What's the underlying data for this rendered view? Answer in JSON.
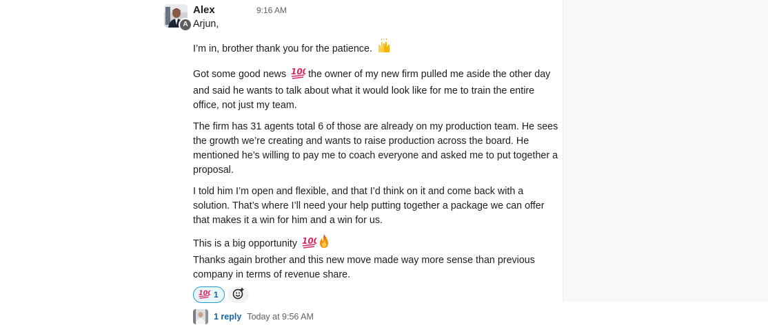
{
  "message": {
    "sender": "Alex",
    "avatar_initial": "A",
    "time": "9:16 AM",
    "paragraphs": [
      {
        "lines": [
          "Arjun,"
        ]
      },
      {
        "lines": [
          "I’m in, brother thank you for the patience."
        ],
        "trailing_emoji": "raised-hands"
      },
      {
        "lines": [
          "Got some good news",
          "and said he wants to talk about what it would look like for me to train the entire",
          "office, not just my team."
        ],
        "inline_emoji": "hundred-points",
        "line1_rest": "the owner of my new firm pulled me aside the other day"
      },
      {
        "lines": [
          "The firm has 31 agents total 6 of those are already on my production team. He sees",
          "the growth we’re creating and wants to raise production across the board. He",
          "mentioned he’s willing to pay me to coach everyone and asked me to put together a",
          "proposal."
        ]
      },
      {
        "lines": [
          "I told him I’m open and flexible, and that I’d think on it and come back with a",
          "solution. That’s where I’ll need your help putting together a package we can offer",
          "that makes it a win for him and a win for us."
        ]
      },
      {
        "lines": [
          "This is a big opportunity"
        ],
        "trailing_emojis": [
          "hundred-points",
          "fire"
        ]
      },
      {
        "lines": [
          "Thanks again brother and this new move made way more sense than previous",
          "company in terms of revenue share."
        ]
      }
    ]
  },
  "reactions": [
    {
      "emoji": "hundred-points",
      "count": "1"
    }
  ],
  "add_reaction_icon": "add-emoji-icon",
  "thread": {
    "reply_label": "1 reply",
    "reply_time": "Today at 9:56 AM"
  },
  "colors": {
    "link": "#1264a3",
    "reaction_border": "#1d9bd1",
    "reaction_bg": "#e8f5fa",
    "hundred_red": "#e0245e",
    "fire_orange": "#f4900c",
    "raised_hands": "#ffcc4d"
  }
}
